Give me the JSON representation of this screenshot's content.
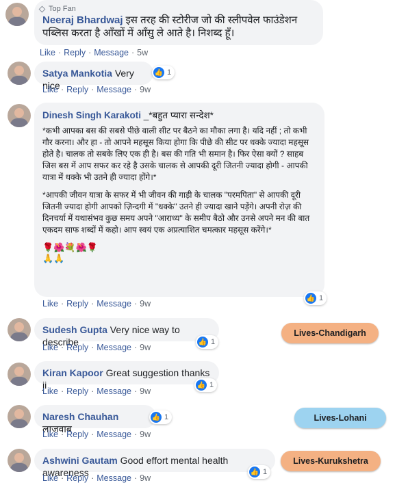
{
  "comments": [
    {
      "badge": "Top Fan",
      "author": "Neeraj Bhardwaj",
      "text": "इस तरह की स्टोरीज जो की स्लीपवेल फाउंडेशन पब्लिस करता है आँखों में आँसु ले आते है। निशब्द हूँ।",
      "actions": {
        "like": "Like",
        "reply": "Reply",
        "message": "Message",
        "time": "5w"
      }
    },
    {
      "author": "Satya Mankotia",
      "text": "Very nice",
      "likes": "1",
      "actions": {
        "like": "Like",
        "reply": "Reply",
        "message": "Message",
        "time": "9w"
      }
    },
    {
      "author": "Dinesh Singh Karakoti",
      "inline": "_*बहुत प्यारा सन्देश*",
      "paragraphs": [
        "*कभी आपका बस की सबसे पीछे वाली सीट पर बैठने का मौका लगा है। यदि नहीं ; तो कभी गौर करना। और हा - तो आपने महसूस किया होगा कि पीछे की सीट पर धक्के ज्यादा महसूस होते है। चालक तो सबके लिए एक ही है। बस की गति भी समान है। फिर ऐसा क्यों ? साहब जिस बस में आप सफर कर रहे है उसके चालक से आपकी दूरी जितनी ज्यादा होगी - आपकी यात्रा में धक्के भी उतने ही ज्यादा होंगे।*",
        "*आपकी जीवन यात्रा के सफर में भी जीवन की गाड़ी के चालक \"परमपिता\" से आपकी दूरी जितनी ज्यादा होगी आपको ज़िन्दगी में \"धक्के\" उतने ही ज्यादा खाने पड़ेंगे। अपनी रोज़ की दिनचर्या में यथासंभव कुछ समय अपने \"आराध्य\" के समीप बैठो और उनसे अपने मन की बात एकदम साफ शब्दों में कहो। आप स्वयं एक अप्रत्याशित चमत्कार महसूस करेंगे।*"
      ],
      "emoji_line1": "🌹🌺💐🌺🌹",
      "emoji_line2": "🙏🙏",
      "likes": "1",
      "actions": {
        "like": "Like",
        "reply": "Reply",
        "message": "Message",
        "time": "9w"
      }
    },
    {
      "author": "Sudesh Gupta",
      "text": "Very nice way to describe",
      "likes": "1",
      "actions": {
        "like": "Like",
        "reply": "Reply",
        "message": "Message",
        "time": "9w"
      }
    },
    {
      "author": "Kiran Kapoor",
      "text": "Great suggestion thanks ji",
      "likes": "1",
      "actions": {
        "like": "Like",
        "reply": "Reply",
        "message": "Message",
        "time": "9w"
      }
    },
    {
      "author": "Naresh Chauhan",
      "text": "लाजवाब",
      "likes": "1",
      "actions": {
        "like": "Like",
        "reply": "Reply",
        "message": "Message",
        "time": "9w"
      }
    },
    {
      "author": "Ashwini Gautam",
      "text": "Good effort mental health awareness",
      "likes": "1",
      "actions": {
        "like": "Like",
        "reply": "Reply",
        "message": "Message",
        "time": "9w"
      }
    }
  ],
  "tags": [
    {
      "label": "Lives-Chandigarh",
      "color": "#f4b183"
    },
    {
      "label": "Lives-Lohani",
      "color": "#9dd3f0"
    },
    {
      "label": "Lives-Kurukshetra",
      "color": "#f4b183"
    }
  ],
  "icons": {
    "like": "thumbs-up-icon",
    "badge": "diamond-icon"
  },
  "colors": {
    "link": "#385898",
    "bubble": "#f2f3f5",
    "like_blue": "#1877f2"
  }
}
